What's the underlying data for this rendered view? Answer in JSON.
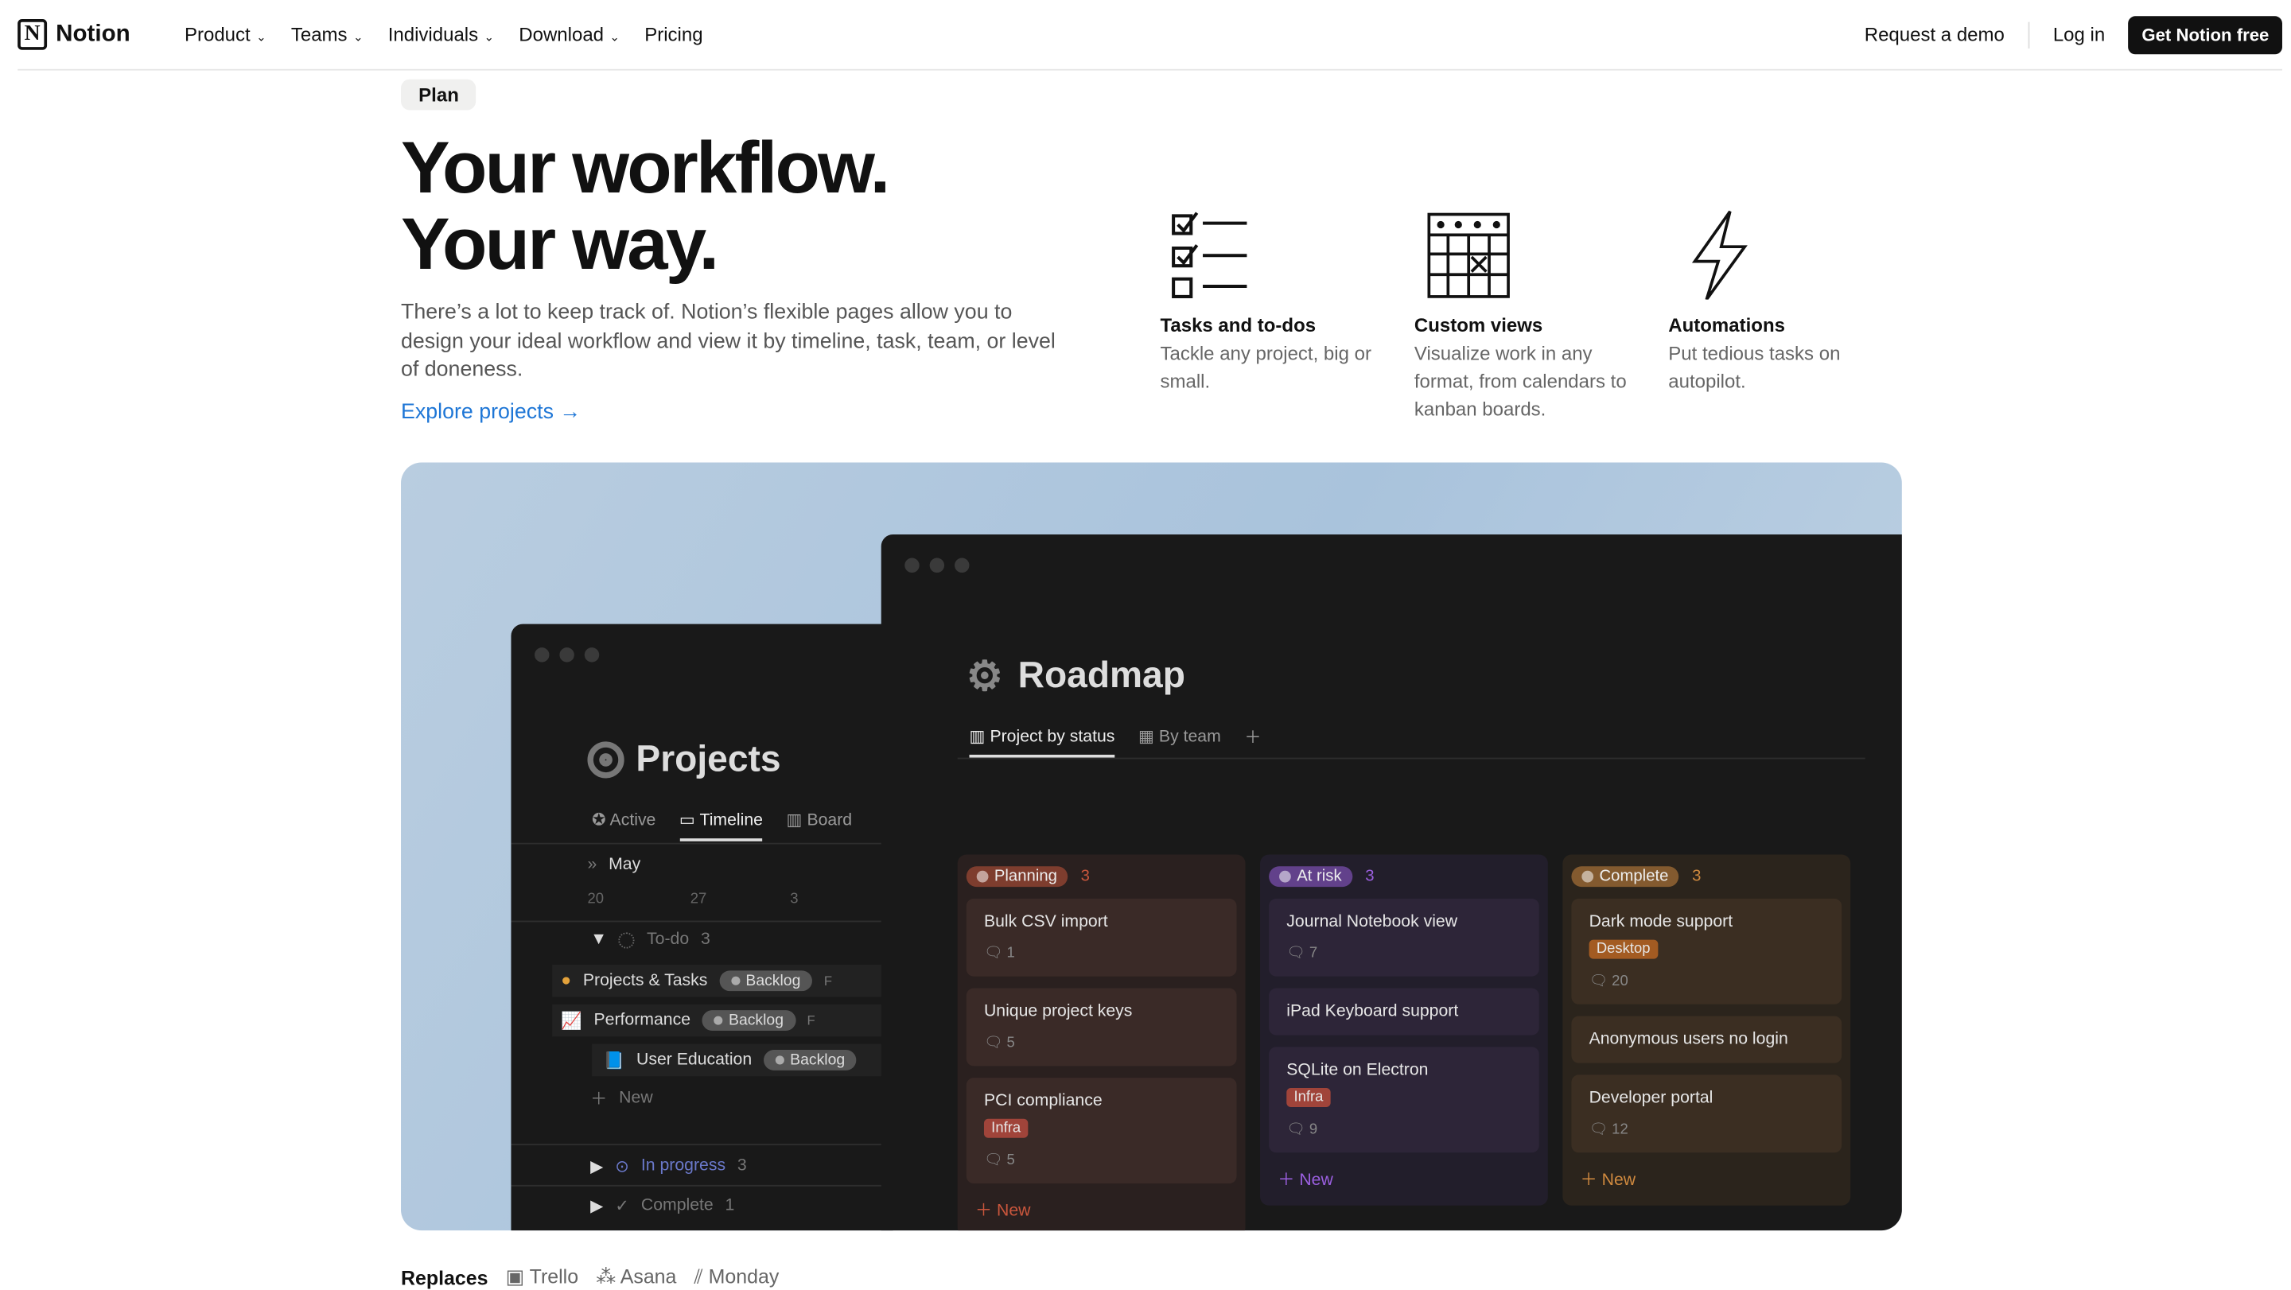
{
  "nav": {
    "brand": "Notion",
    "links": [
      "Product",
      "Teams",
      "Individuals",
      "Download",
      "Pricing"
    ],
    "request_demo": "Request a demo",
    "login": "Log in",
    "cta": "Get Notion free"
  },
  "hero": {
    "badge": "Plan",
    "title_1": "Your workflow.",
    "title_2": "Your way.",
    "description": "There’s a lot to keep track of. Notion’s flexible pages allow you to design your ideal workflow and view it by timeline, task, team, or level of doneness.",
    "explore": "Explore projects →"
  },
  "features": [
    {
      "icon": "checklist-icon",
      "title": "Tasks and to-dos",
      "text": "Tackle any project, big or small."
    },
    {
      "icon": "calendar-icon",
      "title": "Custom views",
      "text": "Visualize work in any format, from calendars to kanban boards."
    },
    {
      "icon": "lightning-icon",
      "title": "Automations",
      "text": "Put tedious tasks on autopilot."
    }
  ],
  "projects": {
    "title": "Projects",
    "tabs": [
      "Active",
      "Timeline",
      "Board"
    ],
    "active_tab": "Timeline",
    "month": "May",
    "dates": [
      "20",
      "27",
      "3"
    ],
    "todo": {
      "label": "To-do",
      "count": "3"
    },
    "items": [
      {
        "name": "Projects & Tasks",
        "status": "Backlog",
        "assignee": "F"
      },
      {
        "name": "Performance",
        "status": "Backlog",
        "assignee": "F"
      },
      {
        "name": "User Education",
        "status": "Backlog"
      }
    ],
    "new": "New",
    "in_progress": {
      "label": "In progress",
      "count": "3"
    },
    "complete": {
      "label": "Complete",
      "count": "1"
    }
  },
  "roadmap": {
    "title": "Roadmap",
    "tabs": [
      "Project by status",
      "By team"
    ],
    "active_tab": "Project by status",
    "columns": [
      {
        "status": "Planning",
        "count": "3",
        "color": "#c9563c",
        "cards": [
          {
            "title": "Bulk CSV import",
            "comments": "1"
          },
          {
            "title": "Unique project keys",
            "comments": "5"
          },
          {
            "title": "PCI compliance",
            "tag": "Infra",
            "comments": "5"
          }
        ],
        "new": "New"
      },
      {
        "status": "At risk",
        "count": "3",
        "color": "#9b5fe0",
        "cards": [
          {
            "title": "Journal Notebook view",
            "comments": "7"
          },
          {
            "title": "iPad Keyboard support"
          },
          {
            "title": "SQLite on Electron",
            "tag": "Infra",
            "comments": "9"
          }
        ],
        "new": "New"
      },
      {
        "status": "Complete",
        "count": "3",
        "color": "#d08a3f",
        "cards": [
          {
            "title": "Dark mode support",
            "tag": "Desktop",
            "comments": "20"
          },
          {
            "title": "Anonymous users no login"
          },
          {
            "title": "Developer portal",
            "comments": "12"
          }
        ],
        "new": "New"
      }
    ]
  },
  "replaces": {
    "label": "Replaces",
    "apps": [
      "Trello",
      "Asana",
      "Monday"
    ]
  }
}
